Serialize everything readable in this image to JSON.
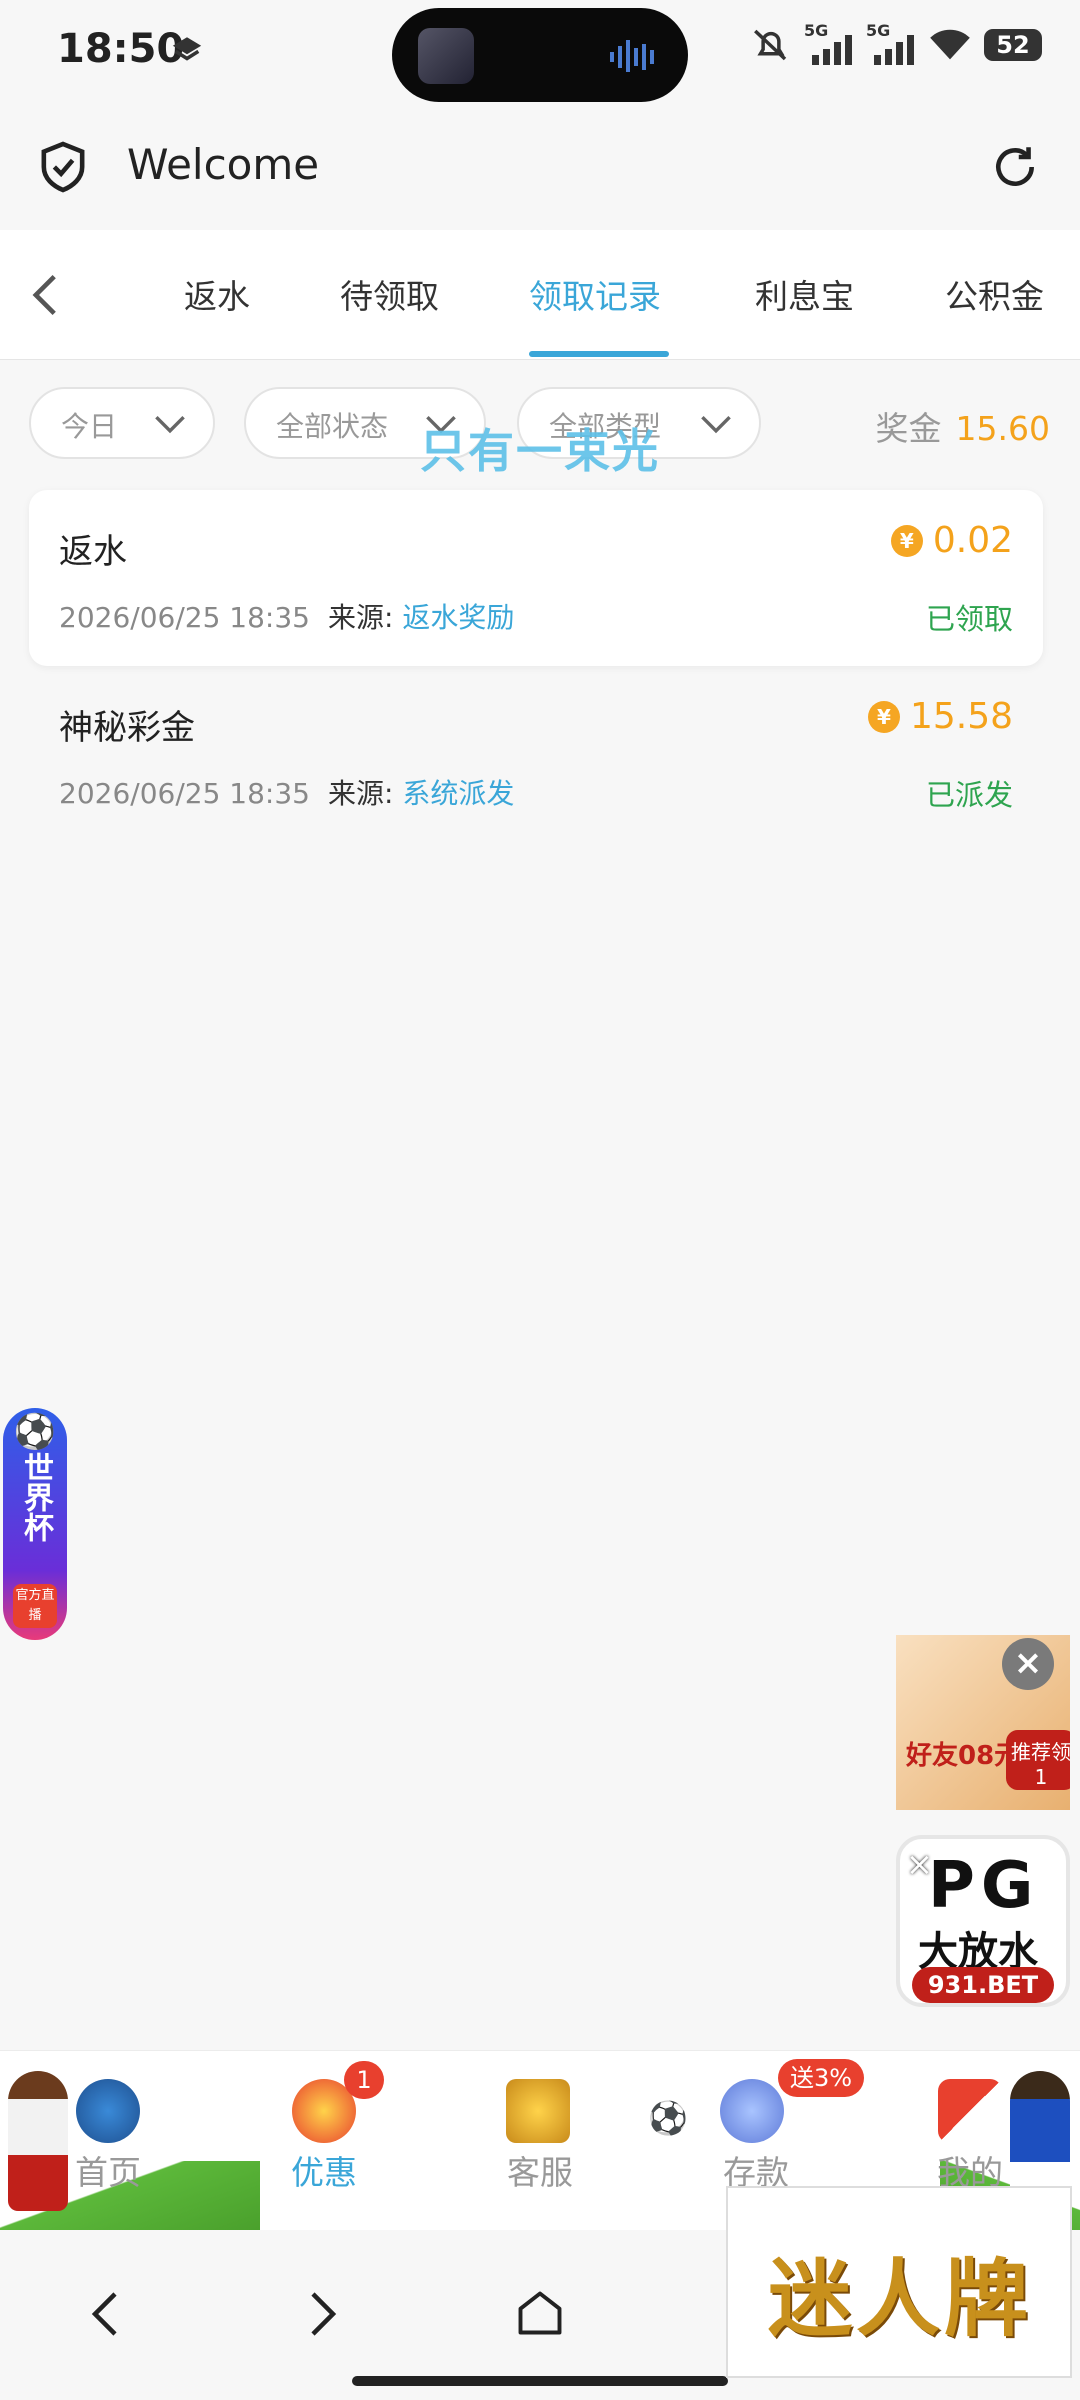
{
  "status_bar": {
    "time": "18:50",
    "battery": "52",
    "network1": "5G",
    "network2": "5G"
  },
  "header": {
    "title": "Welcome"
  },
  "tabs": [
    {
      "label": "返水"
    },
    {
      "label": "待领取"
    },
    {
      "label": "领取记录"
    },
    {
      "label": "利息宝"
    },
    {
      "label": "公积金"
    }
  ],
  "filters": {
    "date": "今日",
    "status": "全部状态",
    "type": "全部类型",
    "prize_label": "奖金",
    "prize_value": "15.60"
  },
  "watermark": "只有一束光",
  "records": [
    {
      "title": "返水",
      "amount": "0.02",
      "date": "2026/06/25 18:35",
      "source_label": "来源:",
      "source": "返水奖励",
      "status": "已领取"
    },
    {
      "title": "神秘彩金",
      "amount": "15.58",
      "date": "2026/06/25 18:35",
      "source_label": "来源:",
      "source": "系统派发",
      "status": "已派发"
    }
  ],
  "floating": {
    "worldcup_text": "世界杯",
    "worldcup_tag": "官方直播",
    "promo_left_text": "好友08元",
    "promo_right_text": "推荐领1",
    "pg_text": "PG",
    "pg_sub": "大放水",
    "pg_domain": "931.BET"
  },
  "bottom_nav": {
    "items": [
      {
        "label": "首页"
      },
      {
        "label": "优惠"
      },
      {
        "label": "客服"
      },
      {
        "label": "存款"
      },
      {
        "label": "我的"
      }
    ],
    "promo_badge": "1",
    "deposit_badge": "送3%"
  },
  "brand_logo": "迷人牌",
  "colors": {
    "accent": "#3aa6d8",
    "gold": "#f4a21b",
    "success": "#2ea44f",
    "badge": "#e8402e"
  }
}
